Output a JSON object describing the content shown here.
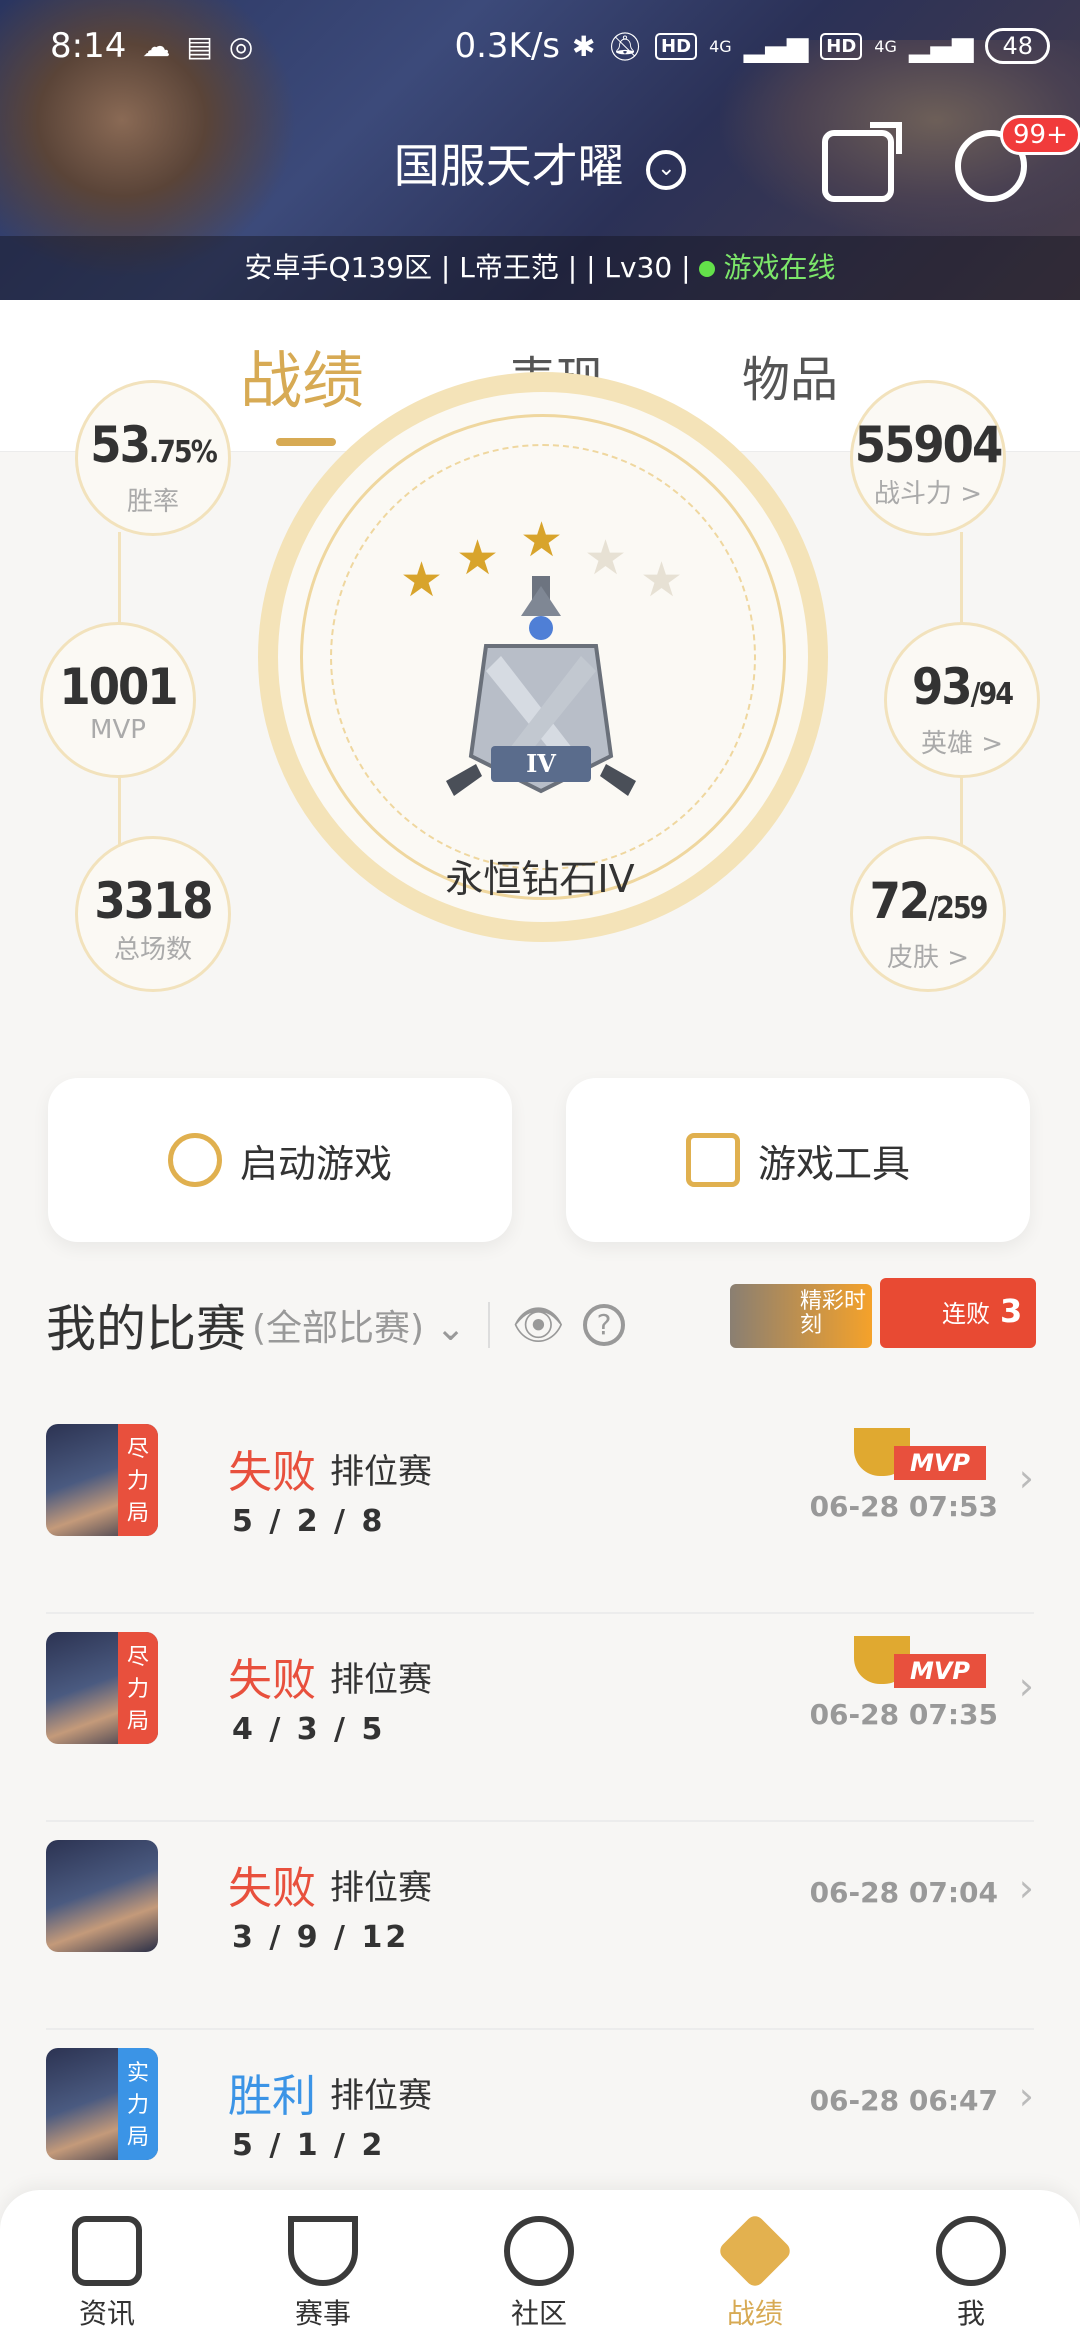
{
  "status_bar": {
    "time": "8:14",
    "net_speed": "0.3K/s",
    "hd1": "HD",
    "net1": "4G",
    "hd2": "HD",
    "net2": "4G",
    "battery": "48"
  },
  "header": {
    "account_name": "国服天才曜",
    "msg_badge": "99+",
    "info_line": "安卓手Q139区 | L帝王范 |  | Lv30 | ",
    "online_status": "游戏在线"
  },
  "tabs": [
    {
      "label": "战绩",
      "active": true
    },
    {
      "label": "表现",
      "active": false
    },
    {
      "label": "物品",
      "active": false
    }
  ],
  "stats_left": [
    {
      "value": "53",
      "value_small": ".75%",
      "label": "胜率"
    },
    {
      "value": "1001",
      "value_small": "",
      "label": "MVP"
    },
    {
      "value": "3318",
      "value_small": "",
      "label": "总场数"
    }
  ],
  "stats_right": [
    {
      "value": "55904",
      "value_small": "",
      "label": "战斗力 >"
    },
    {
      "value": "93",
      "value_small": "/94",
      "label": "英雄 >"
    },
    {
      "value": "72",
      "value_small": "/259",
      "label": "皮肤 >"
    }
  ],
  "rank": {
    "name": "永恒钻石IV",
    "emblem_text": "IV",
    "stars_filled": 3,
    "stars_total": 5
  },
  "actions": {
    "start_game": "启动游戏",
    "game_tools": "游戏工具"
  },
  "matches_header": {
    "title": "我的比赛",
    "filter": "(全部比赛)",
    "highlight": "精彩时刻",
    "streak_label": "连败",
    "streak_count": "3"
  },
  "matches": [
    {
      "tag": "尽力局",
      "tag_color": "#e8503d",
      "result": "失败",
      "mode": "排位赛",
      "kda": "5 / 2 / 8",
      "mvp": true,
      "mvp_label": "MVP",
      "time": "06-28 07:53"
    },
    {
      "tag": "尽力局",
      "tag_color": "#e8503d",
      "result": "失败",
      "mode": "排位赛",
      "kda": "4 / 3 / 5",
      "mvp": true,
      "mvp_label": "MVP",
      "time": "06-28 07:35"
    },
    {
      "tag": "",
      "tag_color": "",
      "result": "失败",
      "mode": "排位赛",
      "kda": "3 / 9 / 12",
      "mvp": false,
      "time": "06-28 07:04"
    },
    {
      "tag": "实力局",
      "tag_color": "#3b94e6",
      "result": "胜利",
      "mode": "排位赛",
      "kda": "5 / 1 / 2",
      "mvp": false,
      "time": "06-28 06:47"
    }
  ],
  "bottom_nav": [
    {
      "label": "资讯",
      "icon": "news-icon",
      "active": false
    },
    {
      "label": "赛事",
      "icon": "trophy-icon",
      "active": false
    },
    {
      "label": "社区",
      "icon": "community-icon",
      "active": false
    },
    {
      "label": "战绩",
      "icon": "record-icon",
      "active": true
    },
    {
      "label": "我",
      "icon": "profile-icon",
      "active": false
    }
  ],
  "colors": {
    "accent": "#d7aa54",
    "lose": "#e8503d",
    "win": "#3b94e6",
    "online": "#63e04a"
  }
}
